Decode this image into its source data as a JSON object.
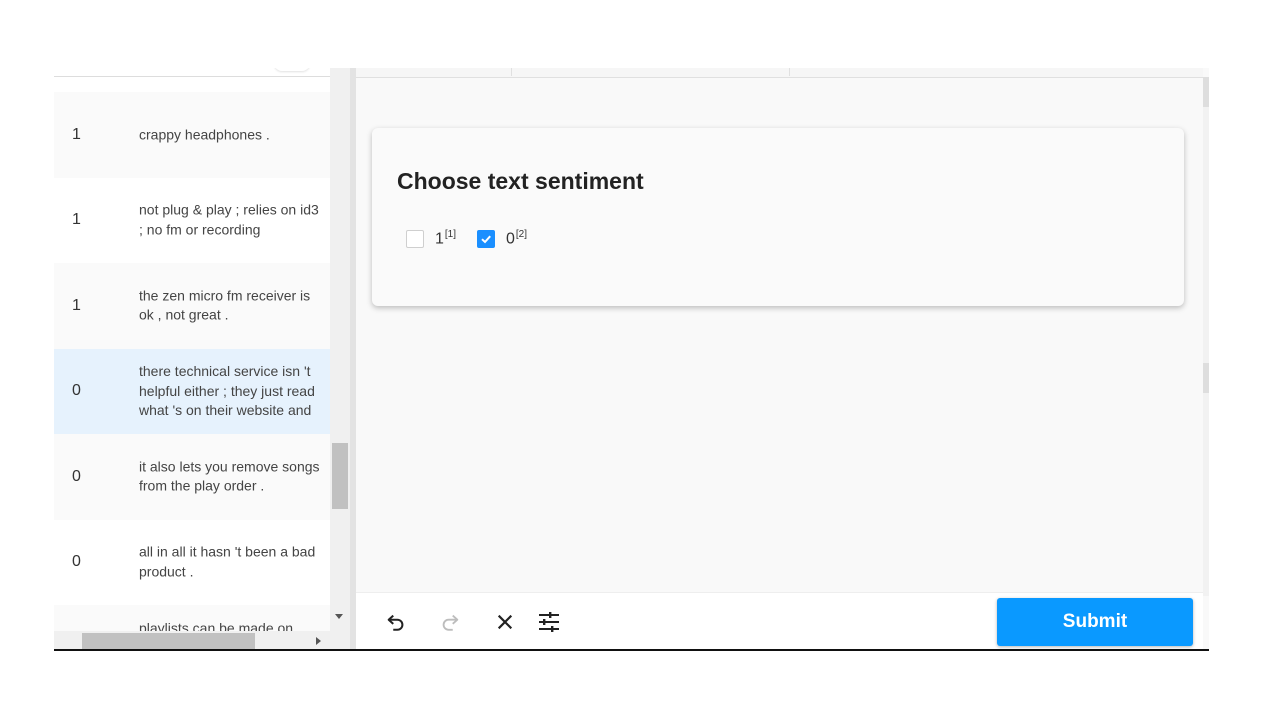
{
  "task_list": {
    "rows": [
      {
        "label": "1",
        "text": "crappy headphones ."
      },
      {
        "label": "1",
        "text": "not plug & play ; relies on id3 ; no fm or recording"
      },
      {
        "label": "1",
        "text": "the zen micro fm receiver is ok , not great ."
      },
      {
        "label": "0",
        "text": "there technical service isn 't helpful either ; they just read what 's on their website and"
      },
      {
        "label": "0",
        "text": "it also lets you remove songs from the play order ."
      },
      {
        "label": "0",
        "text": "all in all it hasn 't been a bad product ."
      },
      {
        "label": "",
        "text": "playlists can be made on"
      }
    ],
    "selected_index": 3
  },
  "annotation": {
    "title": "Choose text sentiment",
    "choices": [
      {
        "label": "1",
        "hotkey": "[1]",
        "checked": false
      },
      {
        "label": "0",
        "hotkey": "[2]",
        "checked": true
      }
    ]
  },
  "toolbar": {
    "icons": [
      "undo-icon",
      "redo-icon",
      "close-icon",
      "settings-sliders-icon"
    ],
    "submit_label": "Submit"
  },
  "colors": {
    "accent": "#0a99ff",
    "selected_row": "#e6f2fd",
    "checkbox_checked": "#1a8fff"
  }
}
